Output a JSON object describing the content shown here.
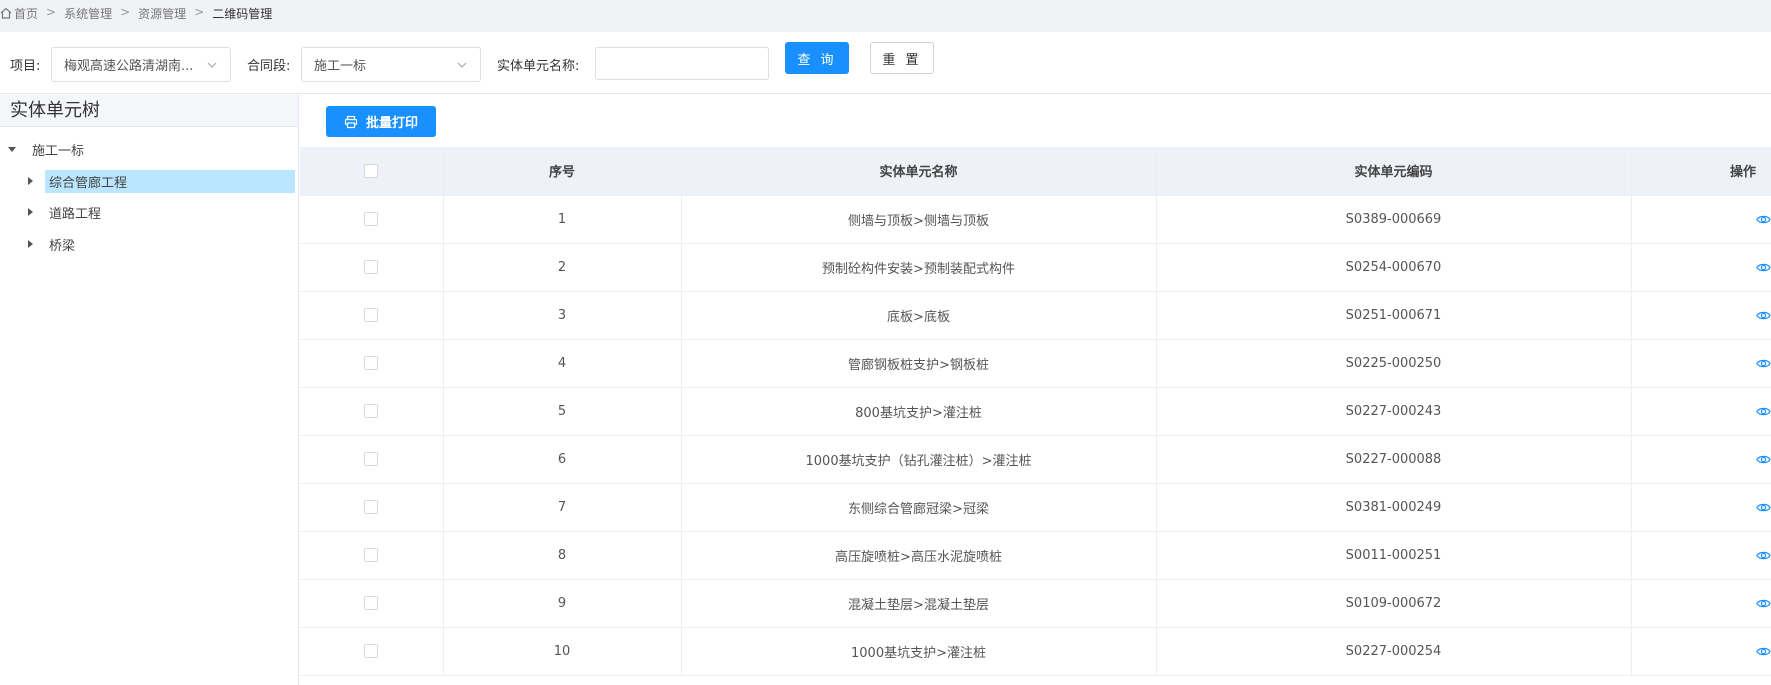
{
  "breadcrumb": {
    "items": [
      "首页",
      "系统管理",
      "资源管理",
      "二维码管理"
    ]
  },
  "filters": {
    "project_label": "项目:",
    "project_value": "梅观高速公路清湖南...",
    "contract_label": "合同段:",
    "contract_value": "施工一标",
    "unit_name_label": "实体单元名称:",
    "unit_name_value": "",
    "search_label": "查 询",
    "reset_label": "重 置"
  },
  "tree": {
    "title": "实体单元树",
    "root": "施工一标",
    "children": [
      "综合管廊工程",
      "道路工程",
      "桥梁"
    ]
  },
  "main": {
    "batch_print_label": "批量打印"
  },
  "table": {
    "columns": [
      "序号",
      "实体单元名称",
      "实体单元编码",
      "操作"
    ],
    "rows": [
      {
        "no": "1",
        "name": "侧墙与顶板>侧墙与顶板",
        "code": "S0389-000669"
      },
      {
        "no": "2",
        "name": "预制砼构件安装>预制装配式构件",
        "code": "S0254-000670"
      },
      {
        "no": "3",
        "name": "底板>底板",
        "code": "S0251-000671"
      },
      {
        "no": "4",
        "name": "管廊钢板桩支护>钢板桩",
        "code": "S0225-000250"
      },
      {
        "no": "5",
        "name": "800基坑支护>灌注桩",
        "code": "S0227-000243"
      },
      {
        "no": "6",
        "name": "1000基坑支护（钻孔灌注桩）>灌注桩",
        "code": "S0227-000088"
      },
      {
        "no": "7",
        "name": "东侧综合管廊冠梁>冠梁",
        "code": "S0381-000249"
      },
      {
        "no": "8",
        "name": "高压旋喷桩>高压水泥旋喷桩",
        "code": "S0011-000251"
      },
      {
        "no": "9",
        "name": "混凝土垫层>混凝土垫层",
        "code": "S0109-000672"
      },
      {
        "no": "10",
        "name": "1000基坑支护>灌注桩",
        "code": "S0227-000254"
      }
    ]
  },
  "colors": {
    "primary": "#1890ff",
    "selected_node": "#bae7ff",
    "header_bg": "#eef1f7"
  }
}
